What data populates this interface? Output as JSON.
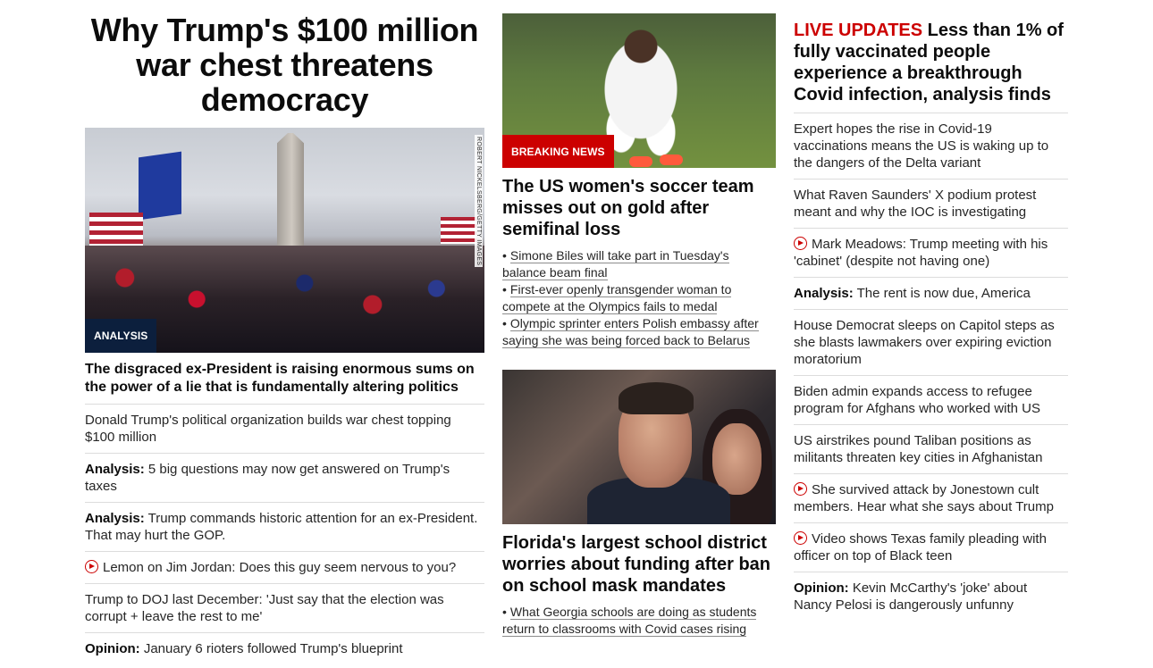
{
  "left": {
    "hero_title": "Why Trump's $100 million war chest threatens democracy",
    "photo_credit": "ROBERT NICKELSBERG/GETTY IMAGES",
    "badge": "ANALYSIS",
    "lead_text": "The disgraced ex-President is raising enormous sums on the power of a lie that is fundamentally altering politics",
    "items": [
      {
        "prefix": "",
        "text": "Donald Trump's political organization builds war chest topping $100 million",
        "video": false
      },
      {
        "prefix": "Analysis:",
        "text": "5 big questions may now get answered on Trump's taxes",
        "video": false
      },
      {
        "prefix": "Analysis:",
        "text": "Trump commands historic attention for an ex-President. That may hurt the GOP.",
        "video": false
      },
      {
        "prefix": "",
        "text": "Lemon on Jim Jordan: Does this guy seem nervous to you?",
        "video": true
      },
      {
        "prefix": "",
        "text": "Trump to DOJ last December: 'Just say that the election was corrupt + leave the rest to me'",
        "video": false
      },
      {
        "prefix": "Opinion:",
        "text": "January 6 rioters followed Trump's blueprint",
        "video": false
      }
    ]
  },
  "middle": {
    "story1": {
      "badge": "BREAKING NEWS",
      "headline": "The US women's soccer team misses out on gold after semifinal loss",
      "bullets": [
        "Simone Biles will take part in Tuesday's balance beam final",
        "First-ever openly transgender woman to compete at the Olympics fails to medal",
        "Olympic sprinter enters Polish embassy after saying she was being forced back to Belarus"
      ]
    },
    "story2": {
      "headline": "Florida's largest school district worries about funding after ban on school mask mandates",
      "bullets": [
        "What Georgia schools are doing as students return to classrooms with Covid cases rising"
      ]
    }
  },
  "right": {
    "live_tag": "LIVE UPDATES",
    "live_headline": "Less than 1% of fully vaccinated people experience a breakthrough Covid infection, analysis finds",
    "items": [
      {
        "prefix": "",
        "text": "Expert hopes the rise in Covid-19 vaccinations means the US is waking up to the dangers of the Delta variant",
        "video": false
      },
      {
        "prefix": "",
        "text": "What Raven Saunders' X podium protest meant and why the IOC is investigating",
        "video": false
      },
      {
        "prefix": "",
        "text": "Mark Meadows: Trump meeting with his 'cabinet' (despite not having one)",
        "video": true
      },
      {
        "prefix": "Analysis:",
        "text": "The rent is now due, America",
        "video": false
      },
      {
        "prefix": "",
        "text": "House Democrat sleeps on Capitol steps as she blasts lawmakers over expiring eviction moratorium",
        "video": false
      },
      {
        "prefix": "",
        "text": "Biden admin expands access to refugee program for Afghans who worked with US",
        "video": false
      },
      {
        "prefix": "",
        "text": "US airstrikes pound Taliban positions as militants threaten key cities in Afghanistan",
        "video": false
      },
      {
        "prefix": "",
        "text": "She survived attack by Jonestown cult members. Hear what she says about Trump",
        "video": true
      },
      {
        "prefix": "",
        "text": "Video shows Texas family pleading with officer on top of Black teen",
        "video": true
      },
      {
        "prefix": "Opinion:",
        "text": "Kevin McCarthy's 'joke' about Nancy Pelosi is dangerously unfunny",
        "video": false
      }
    ]
  },
  "colors": {
    "accent_red": "#cc0000",
    "badge_navy": "#0c1f3d",
    "divider": "#dcdcdc"
  }
}
